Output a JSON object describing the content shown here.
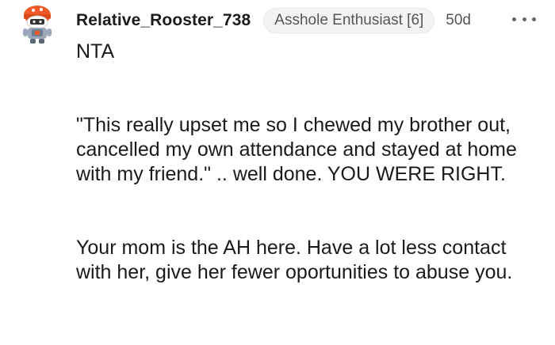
{
  "comment": {
    "username": "Relative_Rooster_738",
    "flair": "Asshole Enthusiast [6]",
    "age": "50d",
    "paragraphs": [
      "NTA",
      "\"This really upset me so I chewed my brother out, cancelled my own attendance and stayed at home with my friend.\" .. well done. YOU WERE RIGHT.",
      "Your mom is the AH here. Have a lot less contact with her, give her fewer oportunities to abuse you."
    ]
  },
  "icons": {
    "avatar": "reddit-snoo-avatar-icon",
    "more": "more-options-icon"
  },
  "colors": {
    "background": "#ffffff",
    "text": "#1a1a1b",
    "muted": "#555555",
    "flair_bg": "#f4f4f4",
    "avatar_orange": "#f05a28"
  }
}
